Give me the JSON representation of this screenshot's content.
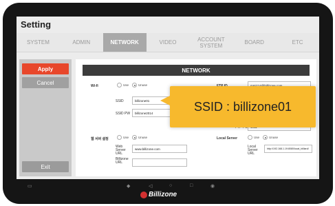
{
  "title": "Setting",
  "tabs": [
    {
      "label": "SYSTEM",
      "active": false
    },
    {
      "label": "ADMIN",
      "active": false
    },
    {
      "label": "NETWORK",
      "active": true
    },
    {
      "label": "VIDEO",
      "active": false
    },
    {
      "label": "ACCOUNT SYSTEM",
      "active": false
    },
    {
      "label": "BOARD",
      "active": false
    },
    {
      "label": "ETC",
      "active": false
    }
  ],
  "sidebar": {
    "apply": "Apply",
    "cancel": "Cancel",
    "exit": "Exit"
  },
  "section_header": "NETWORK",
  "wifi": {
    "label": "Wi-fi",
    "use": "Use",
    "unuse": "Unuse",
    "ssid_label": "SSID",
    "ssid_value": "billizone01",
    "pw_label": "SSID PW",
    "pw_value": "billizone2014"
  },
  "right_partial": {
    "ftp_id": "FTP ID",
    "ftp_id_value": "mmiz14@billizone.com",
    "ftp_port": "FTP PORT",
    "ftp_port_value": "1911"
  },
  "web": {
    "label": "웹 서버 설정",
    "use": "Use",
    "unuse": "Unuse",
    "server_url_label": "Web Server URL",
    "server_url_value": "www.billizone.com",
    "billizone_url_label": "Billizone URL",
    "billizone_url_value": ""
  },
  "local": {
    "label": "Local Server",
    "use": "Use",
    "unuse": "Unuse",
    "url_label": "Local Server URL",
    "url_value": "http://192.168.1.19:8080/local_billiard/"
  },
  "callout": "SSID : billizone01",
  "brand": "Billizone",
  "colors": {
    "apply": "#e8472b",
    "callout": "#f7b92d",
    "header": "#3c3c3c"
  }
}
